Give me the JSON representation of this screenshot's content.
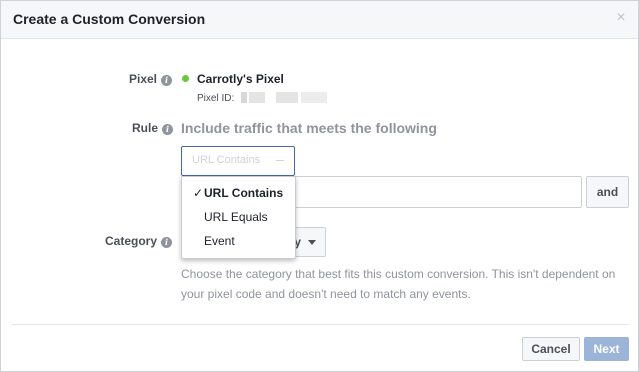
{
  "dialog": {
    "title": "Create a Custom Conversion",
    "close_symbol": "×"
  },
  "pixel": {
    "label": "Pixel",
    "name": "Carrotly's Pixel",
    "id_label": "Pixel ID:",
    "status_color": "#6ec53e"
  },
  "rule": {
    "label": "Rule",
    "description": "Include traffic that meets the following",
    "selected": "URL Contains",
    "url_value": "",
    "and_label": "and",
    "options": [
      "URL Contains",
      "URL Equals",
      "Event"
    ],
    "check_symbol": "✓"
  },
  "category": {
    "label": "Category",
    "selected_fragment": "y",
    "help_text": "Choose the category that best fits this custom conversion. This isn't dependent on your pixel code and doesn't need to match any events."
  },
  "footer": {
    "cancel_label": "Cancel",
    "next_label": "Next"
  },
  "icons": {
    "info": "i"
  },
  "colors": {
    "primary": "#4267b2",
    "disabled_primary": "#9cb4d8",
    "muted_text": "#90949c"
  }
}
